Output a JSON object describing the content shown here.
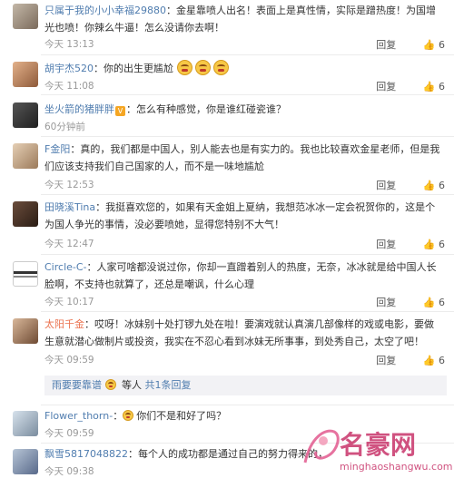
{
  "actions": {
    "reply": "回复",
    "thumb_icon": "thumb-up"
  },
  "colors": {
    "orange_name": "#eb7350",
    "blue_name": "#507daf",
    "text": "#333333",
    "meta": "#999999"
  },
  "comments": [
    {
      "user": "只属于我的小小幸福29880",
      "badge": "",
      "text": "金星靠喷人出名！表面上是真性情，实际是蹭热度！为国增光也喷！你辣么牛逼！怎么没请你去啊！",
      "time": "今天 13:13",
      "likes": "6"
    },
    {
      "user": "胡宇杰520",
      "badge": "",
      "text": "你的出生更尴尬",
      "time": "今天 11:08",
      "likes": "6"
    },
    {
      "user": "坐火箭的猪胖胖",
      "badge": "V",
      "text": "怎么有种感觉，你是谁红碰瓷谁？",
      "time": "60分钟前",
      "likes": ""
    },
    {
      "user": "F金阳",
      "badge": "",
      "text": "真的，我们都是中国人，别人能去也是有实力的。我也比较喜欢金星老师，但是我们应该支持我们自己国家的人，而不是一味地尴尬",
      "time": "今天 12:53",
      "likes": "6"
    },
    {
      "user": "田晓溪Tina",
      "badge": "",
      "text": "我挺喜欢您的，如果有天金姐上夏纳，我想范冰冰一定会祝贺你的，这是个为国人争光的事情，没必要喷她，显得您特别不大气！",
      "time": "今天 12:47",
      "likes": "6"
    },
    {
      "user": "Circle-C-",
      "badge": "",
      "text": "人家可啥都没说过你，你却一直蹭着别人的热度，无奈，冰冰就是给中国人长脸啊，不支持也就算了，还总是嘲讽，什么心理",
      "time": "今天 10:17",
      "likes": "6"
    },
    {
      "user": "太阳千金",
      "badge": "",
      "text": "哎呀！冰妹别十处打锣九处在啦！要演戏就认真演几部像样的戏或电影，要做生意就潜心做制片或投资，我实在不忍心看到冰妹无所事事，到处秀自己，太空了吧！",
      "time": "今天 09:59",
      "likes": "6"
    },
    {
      "user": "Flower_thorn-",
      "badge": "",
      "text": "你们不是和好了吗？",
      "time": "今天 09:59",
      "likes": ""
    },
    {
      "user": "飘雪5817048822",
      "badge": "",
      "text": "每个人的成功都是通过自己的努力得来的，",
      "time": "今天 09:38",
      "likes": ""
    }
  ],
  "subreply": {
    "user": "雨要要靠谱",
    "middle": "等人",
    "count": "共1条回复"
  },
  "watermark": {
    "title": "名豪网",
    "url": "minghaoshangwu.com"
  }
}
